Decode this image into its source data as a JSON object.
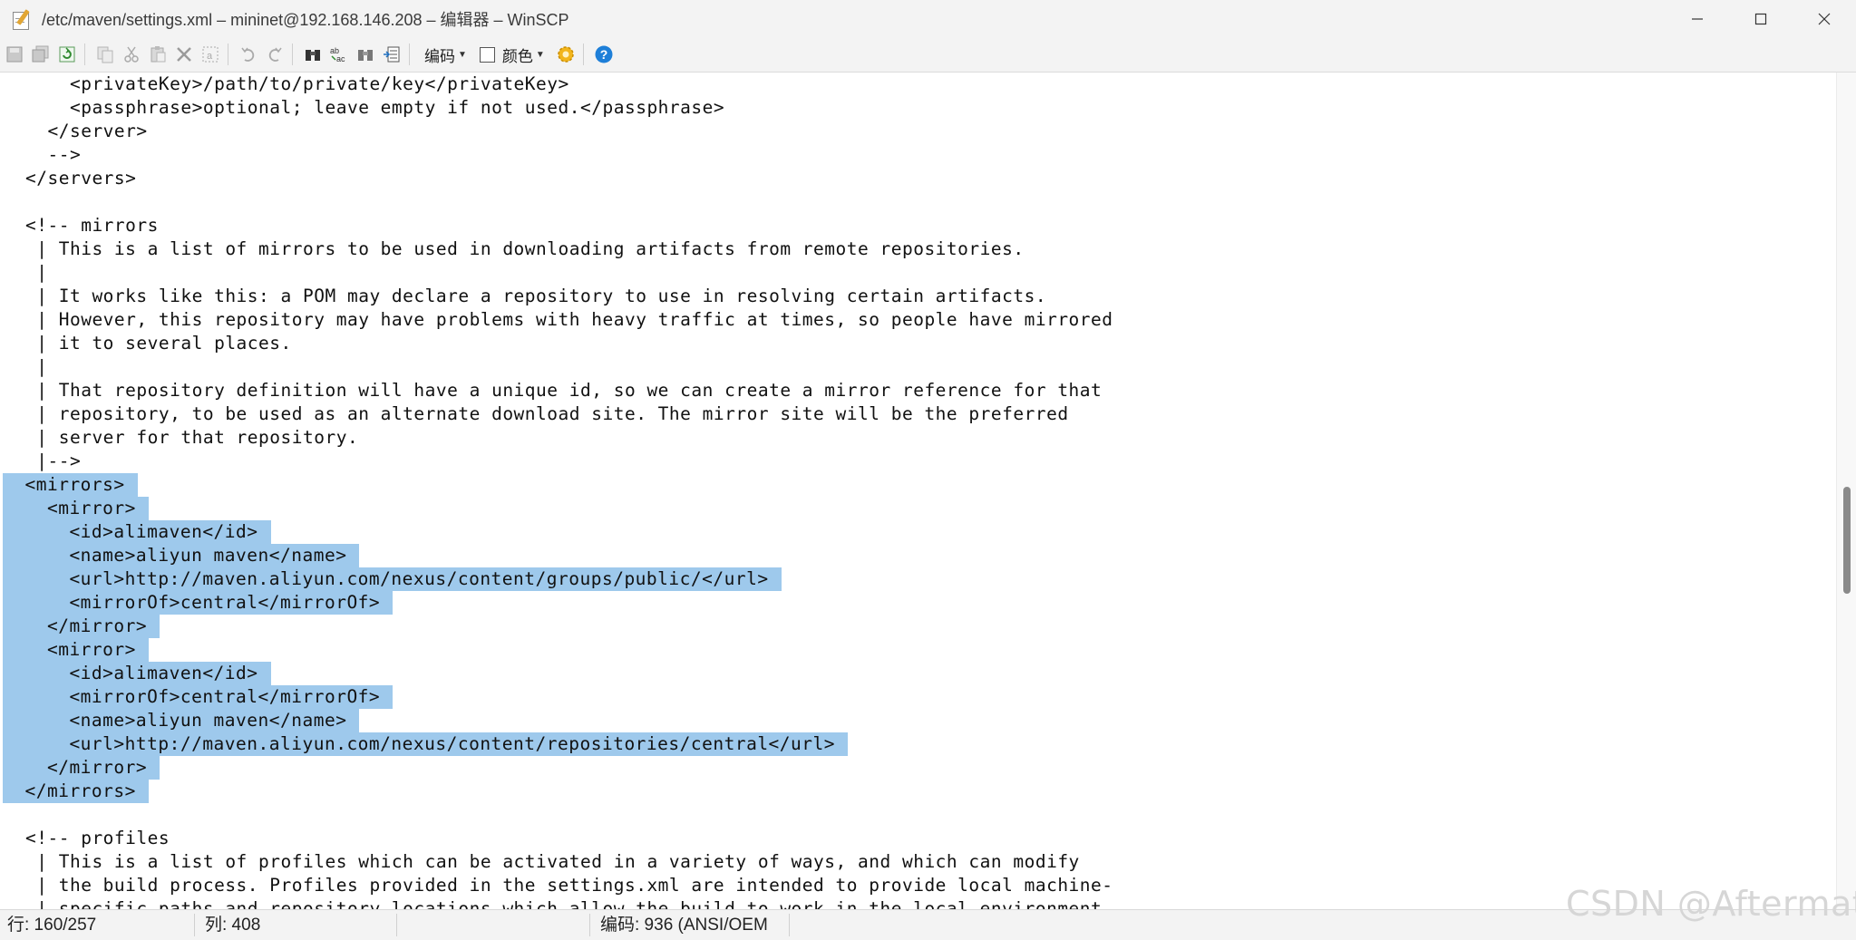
{
  "window": {
    "title": "/etc/maven/settings.xml – mininet@192.168.146.208 – 编辑器 – WinSCP"
  },
  "toolbar": {
    "encoding_label": "编码",
    "color_label": "颜色",
    "icons": [
      "save-icon",
      "save-all-icon",
      "reload-icon",
      "copy-icon",
      "cut-icon",
      "paste-icon",
      "delete-icon",
      "select-all-icon",
      "undo-icon",
      "redo-icon",
      "find-icon",
      "replace-icon",
      "find-next-icon",
      "goto-line-icon",
      "settings-icon",
      "help-icon"
    ]
  },
  "editor": {
    "lines": [
      "    <privateKey>/path/to/private/key</privateKey>",
      "    <passphrase>optional; leave empty if not used.</passphrase>",
      "  </server>",
      "  -->",
      "</servers>",
      "",
      "<!-- mirrors",
      " | This is a list of mirrors to be used in downloading artifacts from remote repositories.",
      " |",
      " | It works like this: a POM may declare a repository to use in resolving certain artifacts.",
      " | However, this repository may have problems with heavy traffic at times, so people have mirrored",
      " | it to several places.",
      " |",
      " | That repository definition will have a unique id, so we can create a mirror reference for that",
      " | repository, to be used as an alternate download site. The mirror site will be the preferred",
      " | server for that repository.",
      " |-->",
      "<mirrors>",
      "  <mirror>",
      "    <id>alimaven</id>",
      "    <name>aliyun maven</name>",
      "    <url>http://maven.aliyun.com/nexus/content/groups/public/</url>",
      "    <mirrorOf>central</mirrorOf>",
      "  </mirror>",
      "  <mirror>",
      "    <id>alimaven</id>",
      "    <mirrorOf>central</mirrorOf>",
      "    <name>aliyun maven</name>",
      "    <url>http://maven.aliyun.com/nexus/content/repositories/central</url>",
      "  </mirror>",
      "</mirrors>",
      "",
      "<!-- profiles",
      " | This is a list of profiles which can be activated in a variety of ways, and which can modify",
      " | the build process. Profiles provided in the settings.xml are intended to provide local machine-",
      " | specific paths and repository locations which allow the build to work in the local environment."
    ]
  },
  "status": {
    "line": "行: 160/257",
    "column": "列: 408",
    "encoding": "编码: 936  (ANSI/OEM"
  },
  "watermark": "CSDN @Aftermath"
}
